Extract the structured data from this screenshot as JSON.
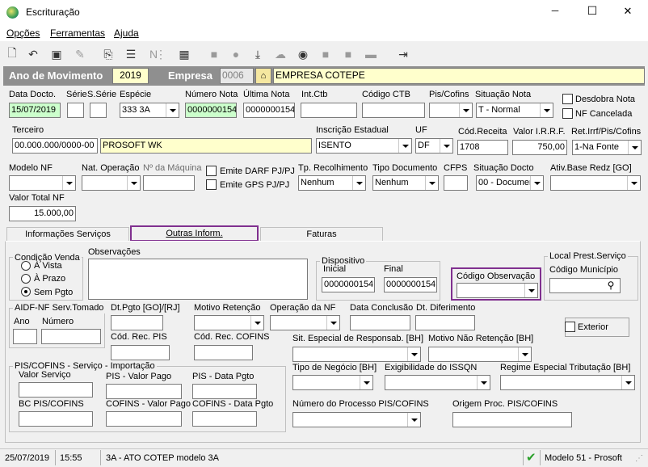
{
  "window": {
    "title": "Escrituração",
    "minimize": "─",
    "maximize": "☐",
    "close": "✕"
  },
  "menu": [
    "Opções",
    "Ferramentas",
    "Ajuda"
  ],
  "header": {
    "ano_label": "Ano de Movimento",
    "ano_value": "2019",
    "empresa_label": "Empresa",
    "empresa_code": "0006",
    "empresa_name": "EMPRESA COTEPE"
  },
  "row1": {
    "data_docto_label": "Data Docto.",
    "data_docto": "15/07/2019",
    "serie_label": "Série",
    "serie": "",
    "sserie_label": "S.Série",
    "sserie": "",
    "especie_label": "Espécie",
    "especie": "333 3A",
    "numero_nota_label": "Número Nota",
    "numero_nota": "0000000154",
    "ultima_nota_label": "Última Nota",
    "ultima_nota": "0000000154",
    "int_ctb_label": "Int.Ctb",
    "int_ctb": "",
    "codigo_ctb_label": "Código CTB",
    "codigo_ctb": "",
    "pis_cofins_label": "Pis/Cofins",
    "pis_cofins": "",
    "situacao_nota_label": "Situação Nota",
    "situacao_nota": "T - Normal",
    "desdobra_label": "Desdobra Nota",
    "nf_cancelada_label": "NF Cancelada"
  },
  "row2": {
    "terceiro_label": "Terceiro",
    "terceiro_cnpj": "00.000.000/0000-00",
    "terceiro_nome": "PROSOFT WK",
    "ie_label": "Inscrição Estadual",
    "ie": "ISENTO",
    "uf_label": "UF",
    "uf": "DF",
    "cod_receita_label": "Cód.Receita",
    "cod_receita": "1708",
    "valor_irrf_label": "Valor I.R.R.F.",
    "valor_irrf": "750,00",
    "ret_label": "Ret.Irrf/Pis/Cofins",
    "ret": "1-Na Fonte"
  },
  "row3": {
    "modelo_nf_label": "Modelo NF",
    "nat_op_label": "Nat. Operação",
    "num_maquina_label": "Nº da Máquina",
    "emite_darf_label": "Emite DARF PJ/PJ",
    "emite_gps_label": "Emite GPS PJ/PJ",
    "tp_recolhimento_label": "Tp. Recolhimento",
    "tp_recolhimento": "Nenhum",
    "tipo_documento_label": "Tipo Documento",
    "tipo_documento": "Nenhum",
    "cfps_label": "CFPS",
    "situacao_docto_label": "Situação Docto",
    "situacao_docto": "00 - Documen",
    "ativ_base_label": "Ativ.Base Redz [GO]"
  },
  "row4": {
    "valor_total_label": "Valor Total NF",
    "valor_total": "15.000,00"
  },
  "tabs": [
    "Informações Serviços",
    "Outras Inform.",
    "Faturas"
  ],
  "cond_venda": {
    "title": "Condição Venda",
    "options": [
      "À Vista",
      "À Prazo",
      "Sem Pgto"
    ]
  },
  "observacoes_label": "Observações",
  "dispositivo": {
    "title": "Dispositivo",
    "inicial_label": "Inicial",
    "inicial": "0000000154",
    "final_label": "Final",
    "final": "0000000154"
  },
  "codigo_observacao_label": "Código Observação",
  "local_prest": {
    "title": "Local Prest.Serviço",
    "codigo_municipio_label": "Código Município"
  },
  "aidf": {
    "title": "AIDF-NF Serv.Tomado",
    "ano_label": "Ano",
    "numero_label": "Número"
  },
  "dt_pgto_label": "Dt.Pgto [GO]/[RJ]",
  "motivo_retencao_label": "Motivo Retenção",
  "operacao_nf_label": "Operação da NF",
  "data_conclusao_label": "Data Conclusão",
  "dt_diferimento_label": "Dt. Diferimento",
  "exterior_label": "Exterior",
  "cod_rec_pis_label": "Cód. Rec. PIS",
  "cod_rec_cofins_label": "Cód. Rec. COFINS",
  "sit_especial_label": "Sit. Especial de Responsab. [BH]",
  "motivo_nao_ret_label": "Motivo Não Retenção [BH]",
  "import": {
    "title": "PIS/COFINS - Serviço - Importação",
    "valor_servico_label": "Valor Serviço",
    "pis_valor_pago_label": "PIS - Valor Pago",
    "pis_data_pgto_label": "PIS - Data Pgto",
    "bc_label": "BC PIS/COFINS",
    "cofins_valor_pago_label": "COFINS - Valor Pago",
    "cofins_data_pgto_label": "COFINS - Data Pgto"
  },
  "tipo_negocio_label": "Tipo de Negócio [BH]",
  "exigibilidade_label": "Exigibilidade do ISSQN",
  "regime_label": "Regime Especial Tributação [BH]",
  "num_processo_label": "Número do Processo PIS/COFINS",
  "origem_proc_label": "Origem Proc. PIS/COFINS",
  "status": {
    "date": "25/07/2019",
    "time": "15:55",
    "message": "3A - ATO COTEP modelo 3A",
    "model": "Modelo 51 - Prosoft"
  },
  "accent": "#80308f"
}
